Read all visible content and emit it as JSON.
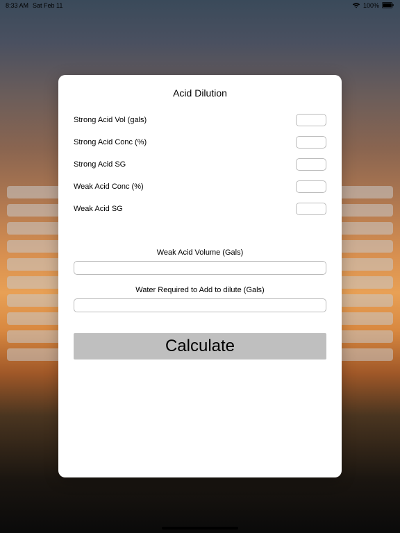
{
  "status": {
    "time": "8:33 AM",
    "date": "Sat Feb 11",
    "battery": "100%"
  },
  "modal": {
    "title": "Acid Dilution",
    "inputs": [
      {
        "label": "Strong Acid Vol (gals)"
      },
      {
        "label": "Strong Acid Conc (%)"
      },
      {
        "label": "Strong Acid SG"
      },
      {
        "label": "Weak Acid Conc (%)"
      },
      {
        "label": "Weak Acid SG"
      }
    ],
    "outputs": [
      {
        "label": "Weak Acid Volume (Gals)"
      },
      {
        "label": "Water Required to Add to dilute (Gals)"
      }
    ],
    "button": "Calculate"
  }
}
